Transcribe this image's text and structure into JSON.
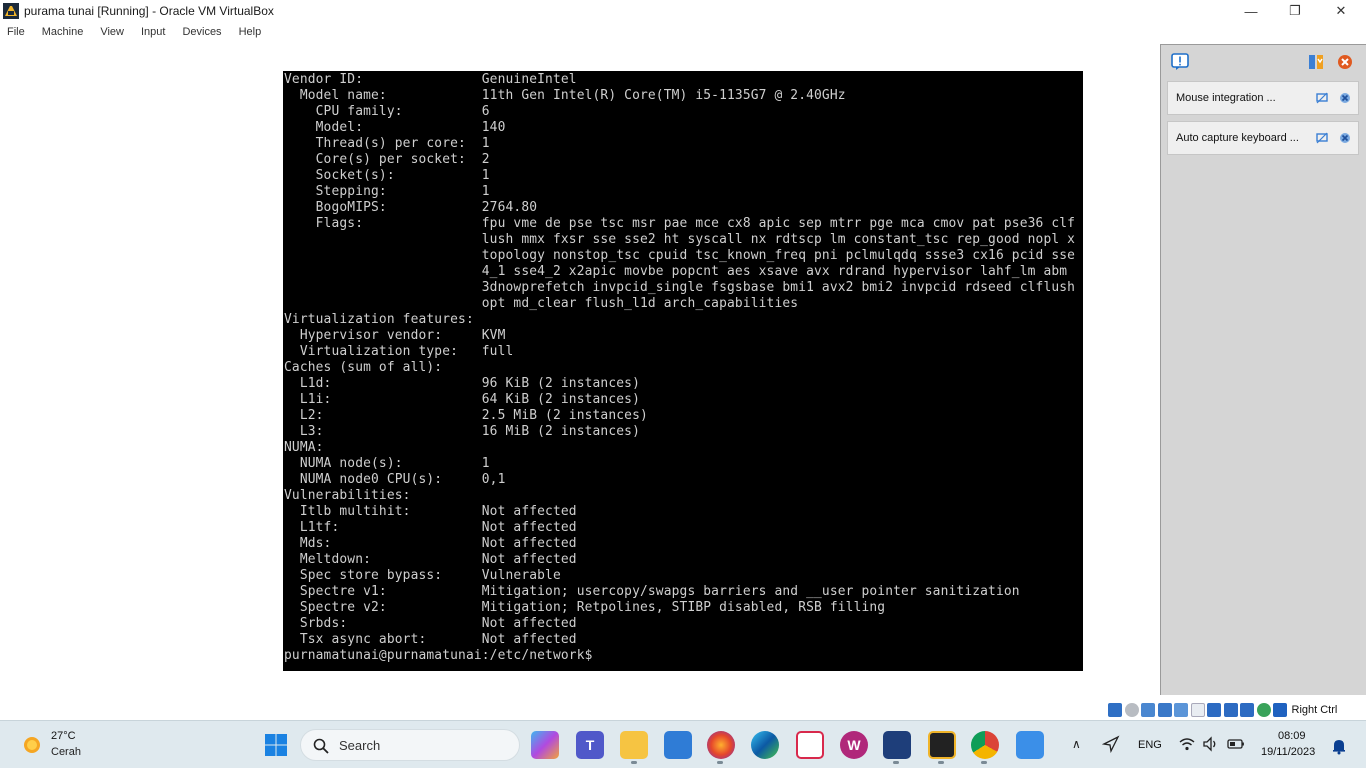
{
  "window": {
    "title": "purama tunai [Running] - Oracle VM VirtualBox",
    "controls": {
      "minimize": "—",
      "maximize": "❐",
      "close": "✕"
    }
  },
  "menu": [
    "File",
    "Machine",
    "View",
    "Input",
    "Devices",
    "Help"
  ],
  "terminal": {
    "lines": [
      "Vendor ID:               GenuineIntel",
      "  Model name:            11th Gen Intel(R) Core(TM) i5-1135G7 @ 2.40GHz",
      "    CPU family:          6",
      "    Model:               140",
      "    Thread(s) per core:  1",
      "    Core(s) per socket:  2",
      "    Socket(s):           1",
      "    Stepping:            1",
      "    BogoMIPS:            2764.80",
      "    Flags:               fpu vme de pse tsc msr pae mce cx8 apic sep mtrr pge mca cmov pat pse36 clf",
      "                         lush mmx fxsr sse sse2 ht syscall nx rdtscp lm constant_tsc rep_good nopl x",
      "                         topology nonstop_tsc cpuid tsc_known_freq pni pclmulqdq ssse3 cx16 pcid sse",
      "                         4_1 sse4_2 x2apic movbe popcnt aes xsave avx rdrand hypervisor lahf_lm abm",
      "                         3dnowprefetch invpcid_single fsgsbase bmi1 avx2 bmi2 invpcid rdseed clflush",
      "                         opt md_clear flush_l1d arch_capabilities",
      "Virtualization features:",
      "  Hypervisor vendor:     KVM",
      "  Virtualization type:   full",
      "Caches (sum of all):",
      "  L1d:                   96 KiB (2 instances)",
      "  L1i:                   64 KiB (2 instances)",
      "  L2:                    2.5 MiB (2 instances)",
      "  L3:                    16 MiB (2 instances)",
      "NUMA:",
      "  NUMA node(s):          1",
      "  NUMA node0 CPU(s):     0,1",
      "Vulnerabilities:",
      "  Itlb multihit:         Not affected",
      "  L1tf:                  Not affected",
      "  Mds:                   Not affected",
      "  Meltdown:              Not affected",
      "  Spec store bypass:     Vulnerable",
      "  Spectre v1:            Mitigation; usercopy/swapgs barriers and __user pointer sanitization",
      "  Spectre v2:            Mitigation; Retpolines, STIBP disabled, RSB filling",
      "  Srbds:                 Not affected",
      "  Tsx async abort:       Not affected",
      "purnamatunai@purnamatunai:/etc/network$"
    ]
  },
  "side_panel": {
    "notifications": [
      {
        "text": "Mouse integration ..."
      },
      {
        "text": "Auto capture keyboard ..."
      }
    ]
  },
  "status_bar": {
    "host_key": "Right Ctrl"
  },
  "taskbar": {
    "weather": {
      "temp": "27°C",
      "desc": "Cerah"
    },
    "search_placeholder": "Search",
    "language": "ENG",
    "time": "08:09",
    "date": "19/11/2023"
  },
  "colors": {
    "console_bg": "#000000",
    "console_text": "#cfcfcf",
    "panel_bg": "#d5d5d5",
    "taskbar_bg": "#dfe9ee",
    "accent": "#0067c0"
  }
}
